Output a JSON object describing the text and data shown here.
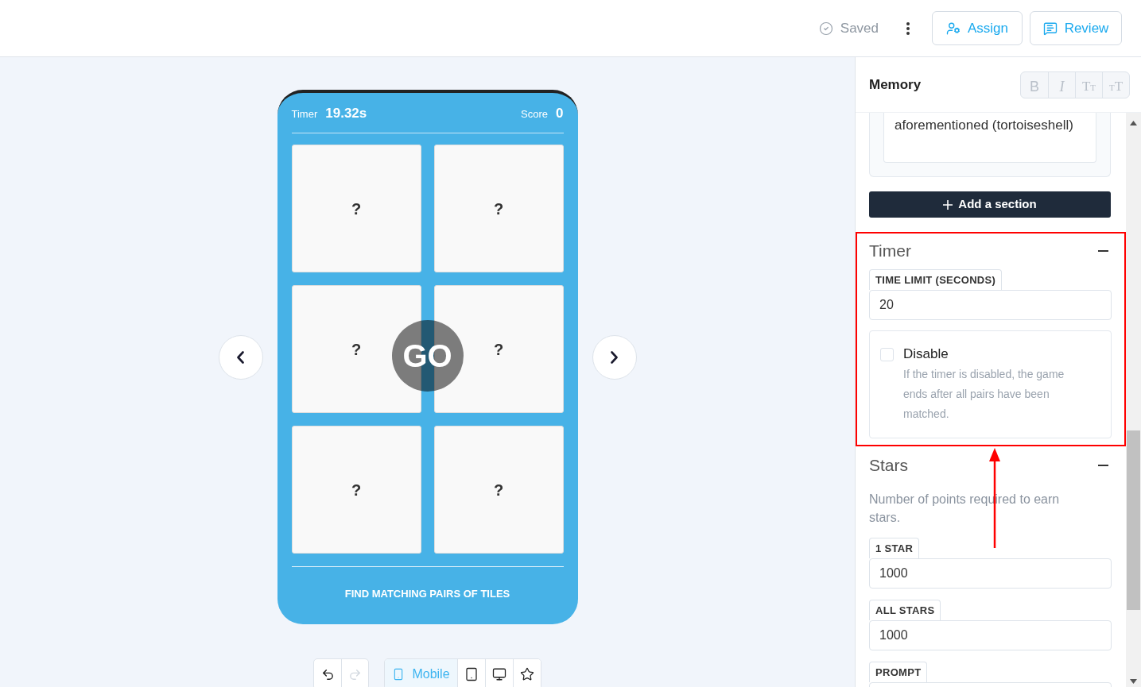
{
  "header": {
    "status": "Saved",
    "actions": [
      {
        "kind": "assign",
        "label": "Assign"
      },
      {
        "kind": "review",
        "label": "Review"
      }
    ]
  },
  "preview": {
    "timer_label": "Timer",
    "timer_value": "19.32s",
    "score_label": "Score",
    "score_value": "0",
    "tiles": [
      {
        "face": "?"
      },
      {
        "face": "?"
      },
      {
        "face": "?"
      },
      {
        "face": "?"
      },
      {
        "face": "?"
      },
      {
        "face": "?"
      }
    ],
    "start_label": "GO",
    "instruction": "FIND MATCHING PAIRS OF TILES"
  },
  "toolbar": {
    "history": [
      {
        "kind": "undo",
        "disabled": false
      },
      {
        "kind": "redo",
        "disabled": true
      }
    ],
    "devices": [
      {
        "kind": "mobile",
        "label": "Mobile",
        "selected": true
      },
      {
        "kind": "tablet",
        "selected": false
      },
      {
        "kind": "desktop",
        "selected": false
      },
      {
        "kind": "star",
        "selected": false
      }
    ]
  },
  "panel": {
    "title": "Memory",
    "format_buttons": [
      {
        "kind": "bold",
        "glyph": "B",
        "disabled": true
      },
      {
        "kind": "italic",
        "glyph": "I",
        "disabled": true
      },
      {
        "kind": "grow",
        "glyph": "TT",
        "disabled": true
      },
      {
        "kind": "shrink",
        "glyph": "TT",
        "disabled": true
      }
    ],
    "text_box": {
      "value": "aforementioned (tortoiseshell)"
    },
    "add_section": {
      "label": "Add a section"
    },
    "sections": [
      {
        "kind": "timer",
        "title": "Timer",
        "expanded": true,
        "highlighted": true,
        "items": [
          {
            "kind": "field",
            "label": "TIME LIMIT (SECONDS)",
            "value": "20"
          },
          {
            "kind": "checkbox",
            "label": "Disable",
            "checked": false,
            "description": "If the timer is disabled, the game ends after all pairs have been matched."
          }
        ]
      },
      {
        "kind": "stars",
        "title": "Stars",
        "expanded": true,
        "items": [
          {
            "kind": "note",
            "text": "Number of points required to earn stars."
          },
          {
            "kind": "field",
            "label": "1 STAR",
            "value": "1000"
          },
          {
            "kind": "field",
            "label": "ALL STARS",
            "value": "1000"
          },
          {
            "kind": "field",
            "label": "PROMPT"
          }
        ]
      }
    ]
  }
}
